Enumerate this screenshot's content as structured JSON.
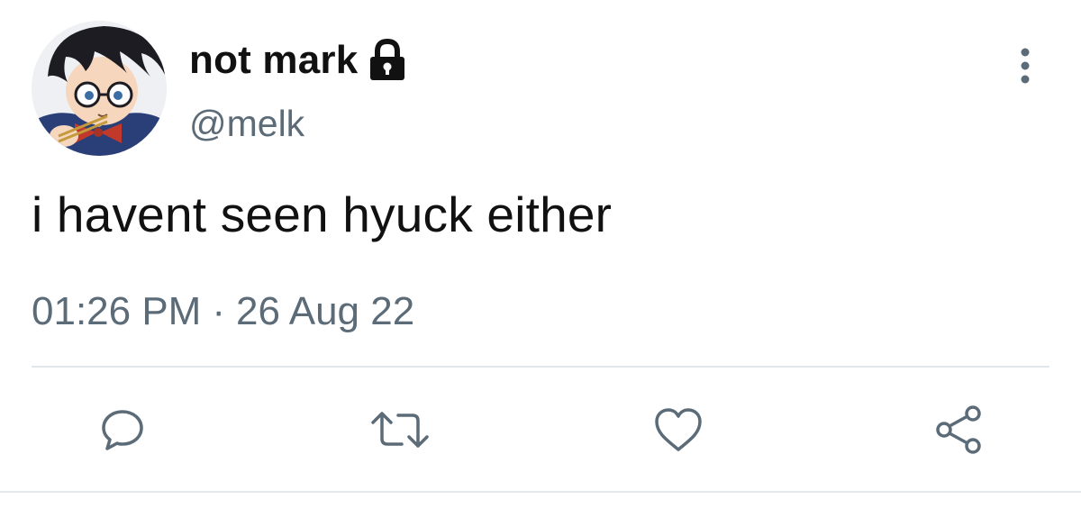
{
  "tweet": {
    "display_name": "not mark",
    "handle": "@melk",
    "text": "i havent seen hyuck either",
    "time": "01:26 PM",
    "separator": "·",
    "date": "26 Aug 22",
    "protected_icon": "lock-icon",
    "menu_icon": "more-vertical-icon",
    "avatar": "profile-avatar"
  },
  "actions": [
    {
      "name": "reply",
      "icon": "comment-icon"
    },
    {
      "name": "retweet",
      "icon": "retweet-icon"
    },
    {
      "name": "like",
      "icon": "heart-icon"
    },
    {
      "name": "share",
      "icon": "share-icon"
    }
  ],
  "colors": {
    "text": "#111111",
    "secondary": "#5b6b78",
    "icon": "#5b6b78",
    "divider": "#e1e6ea",
    "background": "#ffffff"
  }
}
